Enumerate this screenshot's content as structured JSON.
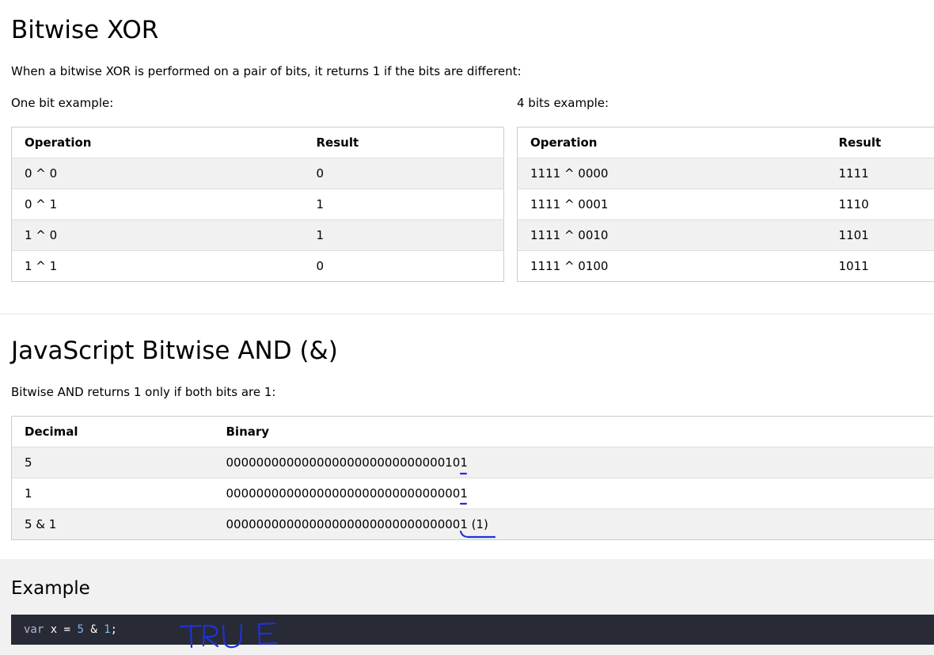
{
  "xor": {
    "title": "Bitwise XOR",
    "intro": "When a bitwise XOR is performed on a pair of bits, it returns 1 if the bits are different:",
    "one_bit_caption": "One bit example:",
    "four_bit_caption": "4 bits example:",
    "one_bit_table": {
      "headers": [
        "Operation",
        "Result"
      ],
      "rows": [
        [
          "0 ^ 0",
          "0"
        ],
        [
          "0 ^ 1",
          "1"
        ],
        [
          "1 ^ 0",
          "1"
        ],
        [
          "1 ^ 1",
          "0"
        ]
      ]
    },
    "four_bit_table": {
      "headers": [
        "Operation",
        "Result"
      ],
      "rows": [
        [
          "1111 ^ 0000",
          "1111"
        ],
        [
          "1111 ^ 0001",
          "1110"
        ],
        [
          "1111 ^ 0010",
          "1101"
        ],
        [
          "1111 ^ 0100",
          "1011"
        ]
      ]
    }
  },
  "and": {
    "title": "JavaScript Bitwise AND (&)",
    "intro": "Bitwise AND returns 1 only if both bits are 1:",
    "table": {
      "headers": [
        "Decimal",
        "Binary"
      ],
      "rows": [
        [
          "5",
          "00000000000000000000000000000101"
        ],
        [
          "1",
          "00000000000000000000000000000001"
        ],
        [
          "5 & 1",
          "00000000000000000000000000000001 (1)"
        ]
      ]
    }
  },
  "example": {
    "title": "Example",
    "code": {
      "kw": "var",
      "ident": " x = ",
      "num1": "5",
      "op": " & ",
      "num2": "1",
      "end": ";"
    }
  },
  "annotation": {
    "handwritten_text": "TRUE",
    "ink_color": "#1f33d6"
  }
}
